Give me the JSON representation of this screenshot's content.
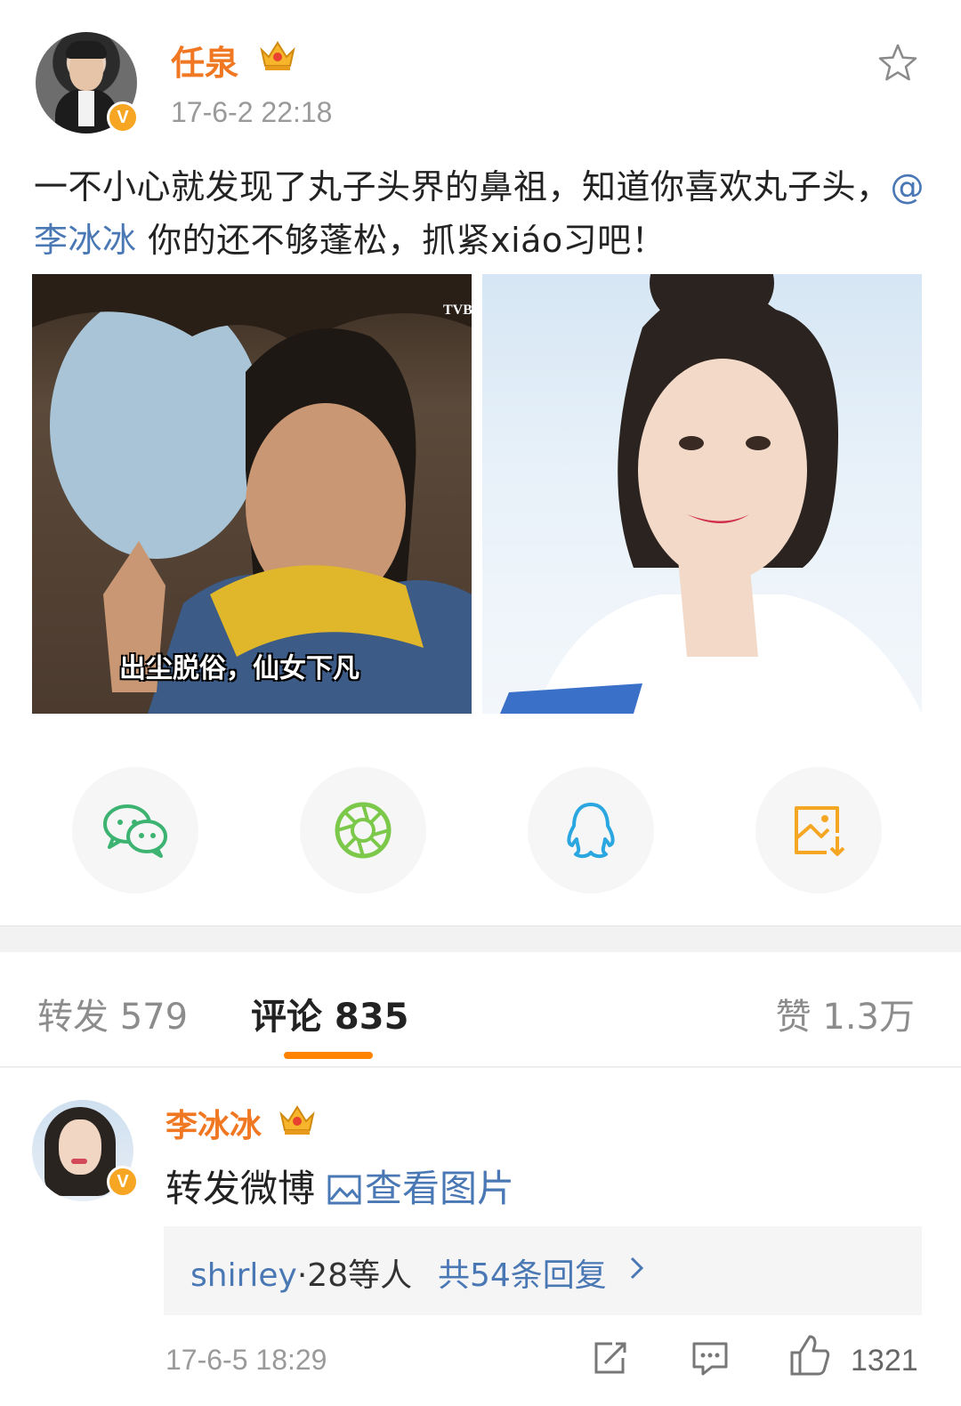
{
  "post": {
    "author": "任泉",
    "time": "17-6-2 22:18",
    "text_part1": "一不小心就发现了丸子头界的鼻祖，知道你喜欢丸子头，",
    "mention": "@李冰冰",
    "text_part2": " 你的还不够蓬松，抓紧xiáo习吧！",
    "photo_left_caption": "出尘脱俗，仙女下凡",
    "photo_left_watermark": "TVB",
    "verified_mark": "V"
  },
  "share": {
    "items": [
      "wechat-icon",
      "moments-icon",
      "qq-icon",
      "save-image-icon"
    ],
    "colors": {
      "wechat": "#3cb371",
      "moments": "#7cc84a",
      "qq": "#2aa6e0",
      "save": "#f5a623"
    }
  },
  "tabs": {
    "repost": "转发 579",
    "comment": "评论 835",
    "like": "赞 1.3万",
    "active_color": "#ff8200"
  },
  "comment": {
    "author": "李冰冰",
    "text": "转发微博",
    "link": "查看图片",
    "reply_names": "shirley",
    "reply_mid": "·28等人",
    "reply_count": "共54条回复",
    "time": "17-6-5 18:29",
    "likes": "1321"
  },
  "colors": {
    "name": "#f17822",
    "link": "#4a78b4",
    "muted": "#9a9a9a"
  }
}
